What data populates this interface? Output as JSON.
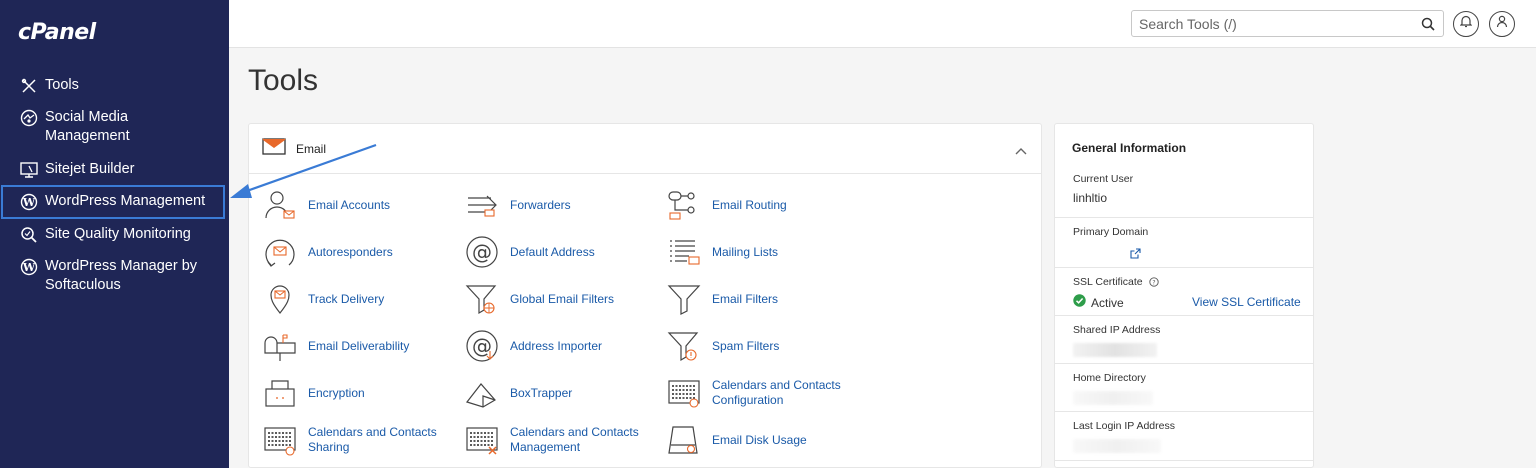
{
  "brand": {
    "logo_text": "cPanel"
  },
  "sidebar": {
    "items": [
      {
        "label": "Tools",
        "icon": "tools-icon"
      },
      {
        "label": "Social Media Management",
        "icon": "social-media-icon"
      },
      {
        "label": "Sitejet Builder",
        "icon": "sitejet-icon"
      },
      {
        "label": "WordPress Management",
        "icon": "wordpress-icon",
        "active": true
      },
      {
        "label": "Site Quality Monitoring",
        "icon": "site-quality-icon"
      },
      {
        "label": "WordPress Manager by Softaculous",
        "icon": "wordpress-icon"
      }
    ]
  },
  "topbar": {
    "search_placeholder": "Search Tools (/)",
    "icons": [
      "search-icon",
      "bell-icon",
      "user-icon"
    ]
  },
  "page": {
    "title": "Tools"
  },
  "email_panel": {
    "title": "Email",
    "tools": [
      {
        "label": "Email Accounts",
        "icon": "email-accounts-icon"
      },
      {
        "label": "Forwarders",
        "icon": "forwarders-icon"
      },
      {
        "label": "Email Routing",
        "icon": "email-routing-icon"
      },
      {
        "label": "Autoresponders",
        "icon": "autoresponders-icon"
      },
      {
        "label": "Default Address",
        "icon": "default-address-icon"
      },
      {
        "label": "Mailing Lists",
        "icon": "mailing-lists-icon"
      },
      {
        "label": "Track Delivery",
        "icon": "track-delivery-icon"
      },
      {
        "label": "Global Email Filters",
        "icon": "global-filters-icon"
      },
      {
        "label": "Email Filters",
        "icon": "email-filters-icon"
      },
      {
        "label": "Email Deliverability",
        "icon": "mailbox-icon"
      },
      {
        "label": "Address Importer",
        "icon": "address-importer-icon"
      },
      {
        "label": "Spam Filters",
        "icon": "spam-filters-icon"
      },
      {
        "label": "Encryption",
        "icon": "encryption-icon"
      },
      {
        "label": "BoxTrapper",
        "icon": "boxtrapper-icon"
      },
      {
        "label": "Calendars and Contacts Configuration",
        "icon": "calendar-config-icon"
      },
      {
        "label": "Calendars and Contacts Sharing",
        "icon": "calendar-sharing-icon"
      },
      {
        "label": "Calendars and Contacts Management",
        "icon": "calendar-management-icon"
      },
      {
        "label": "Email Disk Usage",
        "icon": "disk-usage-icon"
      }
    ]
  },
  "general_info": {
    "title": "General Information",
    "current_user_label": "Current User",
    "current_user": "linhltio",
    "primary_domain_label": "Primary Domain",
    "ssl_label": "SSL Certificate",
    "ssl_status": "Active",
    "ssl_link": "View SSL Certificate",
    "shared_ip_label": "Shared IP Address",
    "home_dir_label": "Home Directory",
    "last_login_label": "Last Login IP Address"
  },
  "colors": {
    "sidebar_bg": "#1f2656",
    "link": "#1a5aa8",
    "accent_orange": "#e8682a",
    "active_outline": "#3a7bd5",
    "arrow": "#3a7bd5"
  }
}
